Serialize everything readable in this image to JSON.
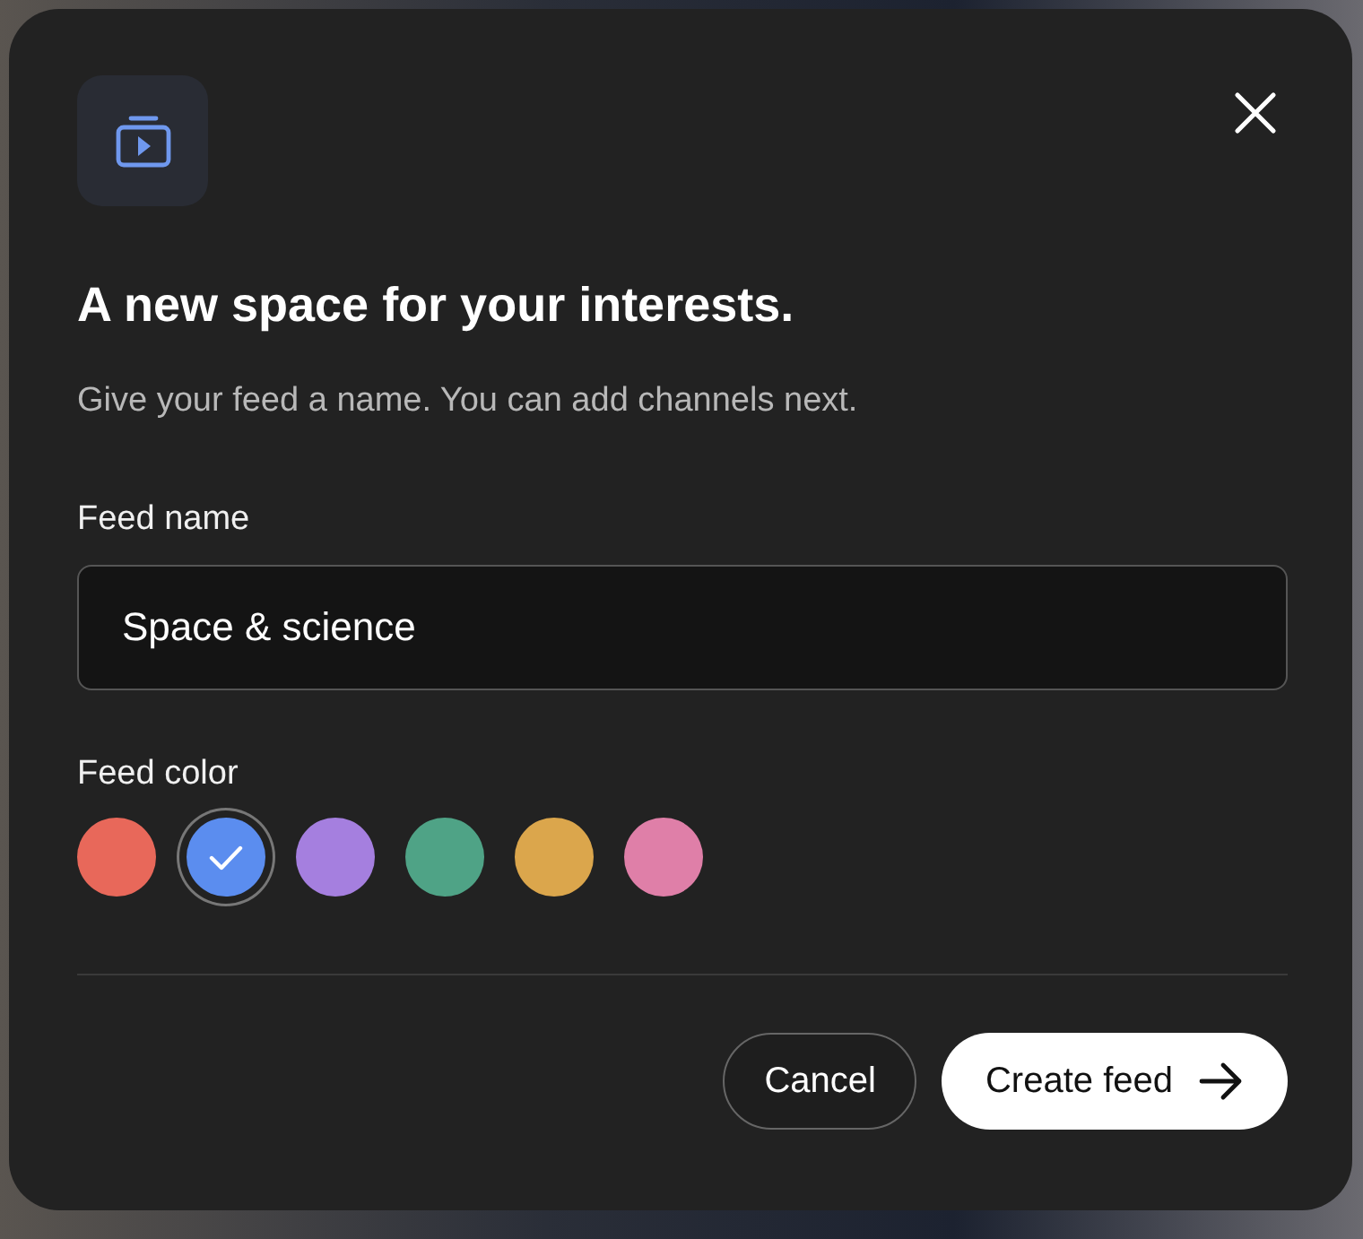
{
  "dialog": {
    "title": "A new space for your interests.",
    "subtitle": "Give your feed a name. You can add channels next.",
    "name_field": {
      "label": "Feed name",
      "value": "Space & science"
    },
    "color_picker": {
      "label": "Feed color",
      "swatches": [
        {
          "color": "#e8685a",
          "selected": false
        },
        {
          "color": "#5b8def",
          "selected": true
        },
        {
          "color": "#a57fdf",
          "selected": false
        },
        {
          "color": "#4fa386",
          "selected": false
        },
        {
          "color": "#dba64c",
          "selected": false
        },
        {
          "color": "#df7fa8",
          "selected": false
        }
      ]
    },
    "buttons": [
      {
        "kind": "secondary",
        "label": "Cancel"
      },
      {
        "kind": "primary",
        "label": "Create feed"
      }
    ]
  }
}
